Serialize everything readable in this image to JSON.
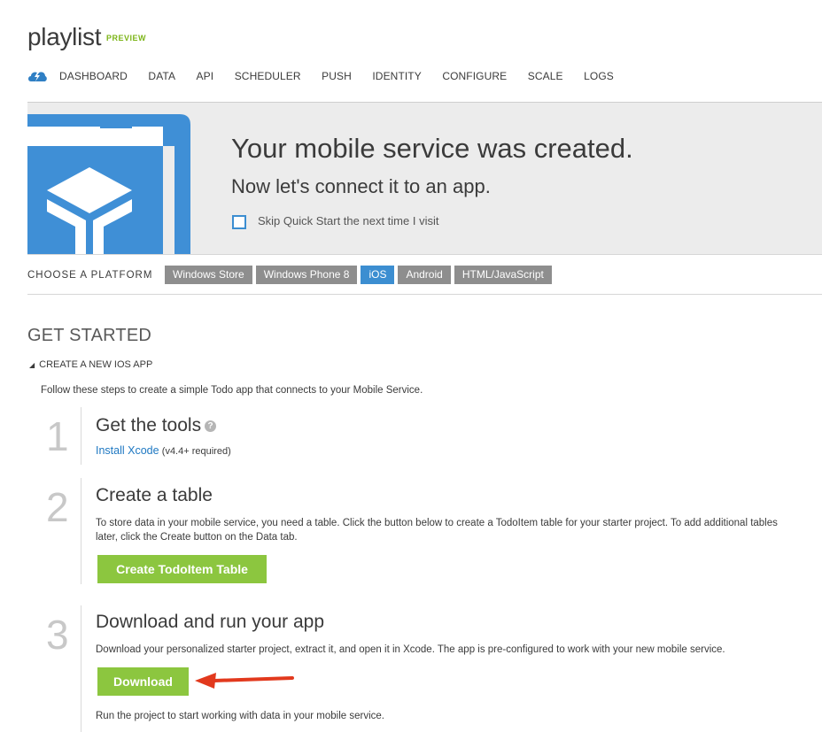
{
  "header": {
    "app_name": "playlist",
    "badge": "PREVIEW"
  },
  "nav": {
    "items": [
      "DASHBOARD",
      "DATA",
      "API",
      "SCHEDULER",
      "PUSH",
      "IDENTITY",
      "CONFIGURE",
      "SCALE",
      "LOGS"
    ]
  },
  "banner": {
    "title": "Your mobile service was created.",
    "subtitle": "Now let's connect it to an app.",
    "skip_label": "Skip Quick Start the next time I visit",
    "skip_checked": false
  },
  "platform": {
    "label": "CHOOSE A PLATFORM",
    "tabs": [
      "Windows Store",
      "Windows Phone 8",
      "iOS",
      "Android",
      "HTML/JavaScript"
    ],
    "selected": "iOS"
  },
  "get_started": {
    "heading": "GET STARTED",
    "section_title": "CREATE A NEW IOS APP",
    "intro": "Follow these steps to create a simple Todo app that connects to your Mobile Service."
  },
  "steps": [
    {
      "number": "1",
      "title": "Get the tools",
      "link_text": "Install Xcode",
      "link_suffix": "(v4.4+ required)"
    },
    {
      "number": "2",
      "title": "Create a table",
      "text_line1": "To store data in your mobile service, you need a table. Click the button below to create a TodoItem table for your starter project. To add additional tables",
      "text_line2": "later, click the Create button on the Data tab.",
      "button_label": "Create TodoItem Table"
    },
    {
      "number": "3",
      "title": "Download and run your app",
      "text": "Download your personalized starter project, extract it, and open it in Xcode. The app is pre-configured to work with your new mobile service.",
      "button_label": "Download",
      "footer": "Run the project to start working with data in your mobile service."
    }
  ],
  "colors": {
    "accent_blue": "#3c8ed1",
    "green_button": "#8cc63f",
    "tab_gray": "#8e8e8e",
    "annotation_arrow": "#e2391d"
  }
}
